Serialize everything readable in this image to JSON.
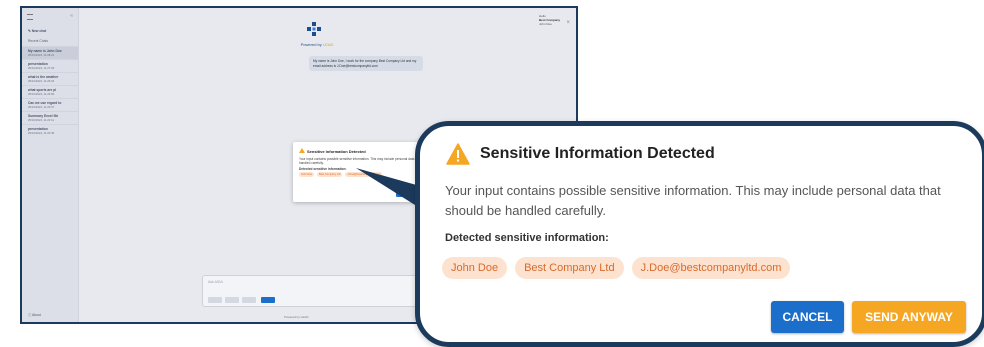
{
  "app": {
    "sidebar": {
      "new_chat": "New chat",
      "section_label": "Recent Chats",
      "items": [
        {
          "title": "My name is John Doe",
          "date": "25/10/2024, 11:28:21"
        },
        {
          "title": "presentation",
          "date": "25/10/2024, 11:27:18"
        },
        {
          "title": "what is the weather",
          "date": "25/10/2024, 11:26:04"
        },
        {
          "title": "what sports are pl",
          "date": "25/10/2024, 11:24:50"
        },
        {
          "title": "Can we use regard to",
          "date": "25/10/2024, 11:23:37"
        },
        {
          "title": "Summary Excel file",
          "date": "25/10/2024, 11:22:11"
        },
        {
          "title": "presentation",
          "date": "25/10/2024, 11:20:45"
        }
      ],
      "about": "About"
    },
    "powered_by": "Powered by",
    "powered_brand": "LEAD",
    "user": {
      "line1": "Hello",
      "name": "Best Company",
      "line3": "John Doe"
    },
    "user_message": "My name is John Doe, I work for the company Best Company Ltd and my email address is J.Doe@bestcompanyltd.com",
    "input_placeholder": "Ask AIDA",
    "footer": "Powered by LEAD",
    "mini_dialog": {
      "title": "Sensitive Information Detected",
      "body": "Your input contains possible sensitive information. This may include personal data that should be handled carefully.",
      "detected_label": "Detected sensitive information:",
      "chips": [
        "John Doe",
        "Best Company Ltd",
        "J.Doe@bestcompanyltd.com"
      ],
      "cancel": "CANCEL",
      "send": "SEND ANYWAY"
    }
  },
  "dialog": {
    "title": "Sensitive Information Detected",
    "body": "Your input contains possible sensitive information. This may include personal data that should be handled carefully.",
    "detected_label": "Detected sensitive information:",
    "chips": [
      "John Doe",
      "Best Company Ltd",
      "J.Doe@bestcompanyltd.com"
    ],
    "cancel_label": "CANCEL",
    "send_label": "SEND ANYWAY"
  },
  "colors": {
    "frame_border": "#1b3a5c",
    "warning": "#f5a623",
    "chip_bg": "#fde3cf",
    "chip_text": "#d9692b",
    "cancel_button": "#1c6ecb",
    "send_button": "#f5a623"
  },
  "icons": {
    "warning": "warning-triangle-icon"
  }
}
